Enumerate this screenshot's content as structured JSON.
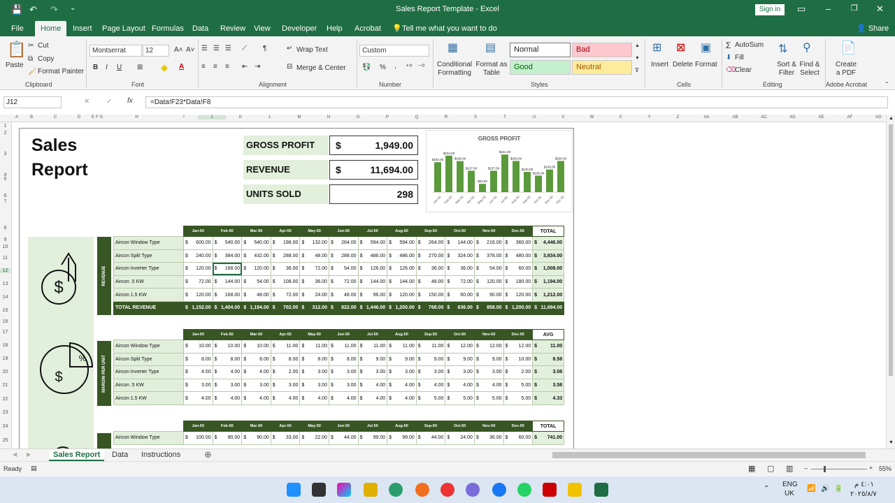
{
  "window": {
    "title": "Sales Report Template  -  Excel",
    "sign_in": "Sign in",
    "minimize": "–",
    "restore": "❐",
    "close": "✕"
  },
  "quick_access": {
    "save": "💾",
    "undo": "↶",
    "redo": "↷",
    "customize": "⌄"
  },
  "menu": {
    "file": "File",
    "tabs": [
      "Home",
      "Insert",
      "Page Layout",
      "Formulas",
      "Data",
      "Review",
      "View",
      "Developer",
      "Help",
      "Acrobat"
    ],
    "tell_me": "Tell me what you want to do",
    "share": "Share"
  },
  "ribbon": {
    "clipboard": {
      "paste": "Paste",
      "cut": "Cut",
      "copy": "Copy",
      "format_painter": "Format Painter",
      "group": "Clipboard"
    },
    "font": {
      "name": "Montserrat",
      "size": "12",
      "group": "Font",
      "bold": "B",
      "italic": "I",
      "underline": "U",
      "grow": "A˄",
      "shrink": "A˅"
    },
    "alignment": {
      "wrap_text": "Wrap Text",
      "merge_center": "Merge & Center",
      "group": "Alignment"
    },
    "number": {
      "format": "Custom",
      "percent": "%",
      "comma": ",",
      "group": "Number"
    },
    "styles": {
      "conditional": "Conditional Formatting",
      "format_table": "Format as Table",
      "normal": "Normal",
      "bad": "Bad",
      "good": "Good",
      "neutral": "Neutral",
      "group": "Styles"
    },
    "cells": {
      "insert": "Insert",
      "delete": "Delete",
      "format": "Format",
      "group": "Cells"
    },
    "editing": {
      "autosum": "AutoSum",
      "fill": "Fill",
      "clear": "Clear",
      "sort_filter": "Sort & Filter",
      "find_select": "Find & Select",
      "group": "Editing"
    },
    "acrobat": {
      "create_pdf": "Create a PDF",
      "group": "Adobe Acrobat"
    }
  },
  "formula_bar": {
    "name_box": "J12",
    "cancel": "✕",
    "enter": "✓",
    "fx": "fx",
    "formula": "=Data!F23*Data!F8"
  },
  "columns": [
    "A",
    "B",
    "C",
    "D",
    "E",
    "F",
    "G",
    "H",
    "I",
    "J",
    "K",
    "L",
    "M",
    "N",
    "O",
    "P",
    "Q",
    "R",
    "S",
    "T",
    "U",
    "V",
    "W",
    "X",
    "Y",
    "Z",
    "AA",
    "AB",
    "AC",
    "AD",
    "AE",
    "AF",
    "AG"
  ],
  "rows": [
    "1",
    "2",
    "3",
    "4",
    "5",
    "6",
    "7",
    "8",
    "9",
    "10",
    "11",
    "12",
    "13",
    "14",
    "15",
    "16",
    "17",
    "18",
    "19",
    "20",
    "21",
    "22",
    "23",
    "24",
    "25"
  ],
  "report": {
    "title_line1": "Sales",
    "title_line2": "Report",
    "kpis": [
      {
        "label": "GROSS PROFIT",
        "currency": "$",
        "value": "1,949.00"
      },
      {
        "label": "REVENUE",
        "currency": "$",
        "value": "11,694.00"
      },
      {
        "label": "UNITS SOLD",
        "currency": "",
        "value": "298"
      }
    ],
    "months": [
      "Jan-50",
      "Feb-50",
      "Mar-50",
      "Apr-50",
      "May-50",
      "Jun-50",
      "Jul-50",
      "Aug-50",
      "Sep-50",
      "Oct-50",
      "Nov-50",
      "Dec-50"
    ],
    "revenue": {
      "band": "REVENUE",
      "total_head": "TOTAL",
      "rows": [
        {
          "label": "Aircon Window Type",
          "values": [
            "600.00",
            "540.00",
            "540.00",
            "198.00",
            "132.00",
            "264.00",
            "594.00",
            "594.00",
            "264.00",
            "144.00",
            "216.00",
            "360.00"
          ],
          "total": "4,446.00"
        },
        {
          "label": "Aircon Split Type",
          "values": [
            "240.00",
            "384.00",
            "432.00",
            "288.00",
            "48.00",
            "288.00",
            "486.00",
            "486.00",
            "270.00",
            "324.00",
            "378.00",
            "480.00"
          ],
          "total": "3,834.00"
        },
        {
          "label": "Aircon Inverter Type",
          "values": [
            "120.00",
            "168.00",
            "120.00",
            "36.00",
            "72.00",
            "54.00",
            "126.00",
            "126.00",
            "36.00",
            "36.00",
            "54.00",
            "60.00"
          ],
          "total": "1,008.00"
        },
        {
          "label": "Aircon .5 KW",
          "values": [
            "72.00",
            "144.00",
            "54.00",
            "108.00",
            "36.00",
            "72.00",
            "144.00",
            "144.00",
            "48.00",
            "72.00",
            "120.00",
            "180.00"
          ],
          "total": "1,194.00"
        },
        {
          "label": "Aircon 1.5 KW",
          "values": [
            "120.00",
            "168.00",
            "48.00",
            "72.00",
            "24.00",
            "48.00",
            "96.00",
            "120.00",
            "150.00",
            "60.00",
            "90.00",
            "120.00"
          ],
          "total": "1,212.00"
        }
      ],
      "total_label": "TOTAL REVENUE",
      "totals": [
        "1,152.00",
        "1,404.00",
        "1,194.00",
        "702.00",
        "312.00",
        "822.00",
        "1,446.00",
        "1,200.00",
        "768.00",
        "636.00",
        "858.00",
        "1,200.00"
      ],
      "grand_total": "11,694.00"
    },
    "margin": {
      "band": "MARGIN PER UNIT",
      "total_head": "AVG",
      "rows": [
        {
          "label": "Aircon Window Type",
          "values": [
            "10.00",
            "10.00",
            "10.00",
            "11.00",
            "11.00",
            "11.00",
            "11.00",
            "11.00",
            "11.00",
            "12.00",
            "12.00",
            "12.00"
          ],
          "total": "11.00"
        },
        {
          "label": "Aircon Split Type",
          "values": [
            "8.00",
            "8.00",
            "8.00",
            "8.00",
            "8.00",
            "8.00",
            "9.00",
            "9.00",
            "9.00",
            "9.00",
            "9.00",
            "10.00"
          ],
          "total": "8.58"
        },
        {
          "label": "Aircon Inverter Type",
          "values": [
            "4.00",
            "4.00",
            "4.00",
            "2.00",
            "3.00",
            "3.00",
            "3.00",
            "3.00",
            "3.00",
            "3.00",
            "3.00",
            "2.00"
          ],
          "total": "3.08"
        },
        {
          "label": "Aircon .5 KW",
          "values": [
            "3.00",
            "3.00",
            "3.00",
            "3.00",
            "3.00",
            "3.00",
            "4.00",
            "4.00",
            "4.00",
            "4.00",
            "4.00",
            "5.00"
          ],
          "total": "3.58"
        },
        {
          "label": "Aircon 1.5 KW",
          "values": [
            "4.00",
            "4.00",
            "4.00",
            "4.00",
            "4.00",
            "4.00",
            "4.00",
            "4.00",
            "5.00",
            "5.00",
            "5.00",
            "5.00"
          ],
          "total": "4.33"
        }
      ]
    },
    "profit": {
      "total_head": "TOTAL",
      "rows": [
        {
          "label": "Aircon Window Type",
          "values": [
            "100.00",
            "90.00",
            "90.00",
            "33.00",
            "22.00",
            "44.00",
            "99.00",
            "99.00",
            "44.00",
            "24.00",
            "36.00",
            "60.00"
          ],
          "total": "741.00"
        }
      ]
    }
  },
  "chart_data": {
    "type": "bar",
    "title": "GROSS PROFIT",
    "categories": [
      "Jan-50",
      "Feb-50",
      "Mar-50",
      "Apr-50",
      "May-50",
      "Jun-50",
      "Jul-50",
      "Aug-50",
      "Sep-50",
      "Oct-50",
      "Nov-50",
      "Dec-50"
    ],
    "values": [
      192,
      234,
      199,
      137,
      53,
      137,
      241,
      200,
      130,
      106,
      145,
      200
    ],
    "data_labels": [
      "$192.00",
      "$234.00",
      "$199.00",
      "$137.00",
      "$53.00",
      "$137.00",
      "$241.00",
      "$200.00",
      "$130.00",
      "$106.00",
      "$145.00",
      "$200.00"
    ],
    "ylim": [
      0,
      260
    ],
    "bar_color": "#5a9a3a"
  },
  "sheet_tabs": [
    "Sales Report",
    "Data",
    "Instructions"
  ],
  "status": {
    "ready": "Ready",
    "zoom": "55%",
    "minus": "–",
    "plus": "+"
  },
  "taskbar": {
    "lang_line1": "ENG",
    "lang_line2": "UK",
    "time": "٤:٠١ م",
    "date": "٢٠٢٥/٨/٧"
  },
  "colors": {
    "excel_green": "#1f6e43",
    "dark_green": "#375623",
    "light_green": "#e2efdb"
  }
}
